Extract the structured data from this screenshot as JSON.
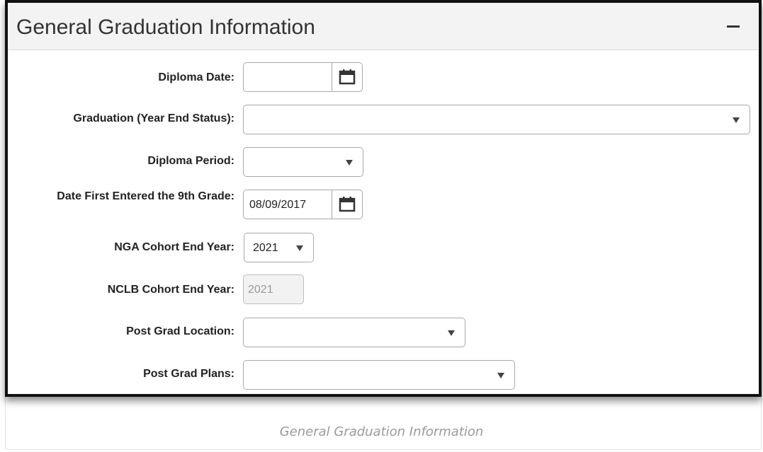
{
  "panel": {
    "title": "General Graduation Information",
    "collapse_icon": "minus-icon"
  },
  "fields": {
    "diploma_date": {
      "label": "Diploma Date:",
      "value": "",
      "icon": "calendar-icon"
    },
    "graduation_status": {
      "label": "Graduation (Year End Status):",
      "value": ""
    },
    "diploma_period": {
      "label": "Diploma Period:",
      "value": ""
    },
    "date_first_9th": {
      "label": "Date First Entered the 9th Grade:",
      "value": "08/09/2017",
      "icon": "calendar-icon"
    },
    "nga_cohort": {
      "label": "NGA Cohort End Year:",
      "value": "2021"
    },
    "nclb_cohort": {
      "label": "NCLB Cohort End Year:",
      "value": "2021"
    },
    "post_grad_location": {
      "label": "Post Grad Location:",
      "value": ""
    },
    "post_grad_plans": {
      "label": "Post Grad Plans:",
      "value": ""
    }
  },
  "caption": "General Graduation Information"
}
